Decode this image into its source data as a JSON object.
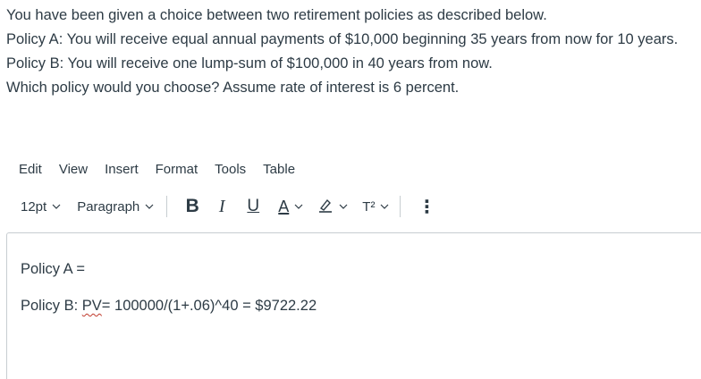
{
  "question": {
    "line1": "You have been given a choice between two retirement policies as described below.",
    "line2": "Policy A: You will receive equal annual payments of $10,000 beginning 35 years from now for 10 years.",
    "line3": "Policy B: You will receive one lump-sum of $100,000 in 40 years from now.",
    "line4": "Which policy would you choose? Assume rate of interest is 6 percent."
  },
  "menubar": {
    "edit": "Edit",
    "view": "View",
    "insert": "Insert",
    "format": "Format",
    "tools": "Tools",
    "table": "Table"
  },
  "toolbar": {
    "font_size": "12pt",
    "block_format": "Paragraph",
    "bold": "B",
    "italic": "I",
    "underline": "U",
    "text_color": "A",
    "superscript": "T²",
    "more": "⋮"
  },
  "editor": {
    "line1": "Policy A =",
    "line2_prefix": "Policy B: ",
    "line2_flagged": "PV",
    "line2_rest": "= 100000/(1+.06)^40 = $9722.22"
  },
  "colors": {
    "text": "#2d3b45",
    "border": "#c7cdd1",
    "spellcheck": "#c0392b"
  }
}
